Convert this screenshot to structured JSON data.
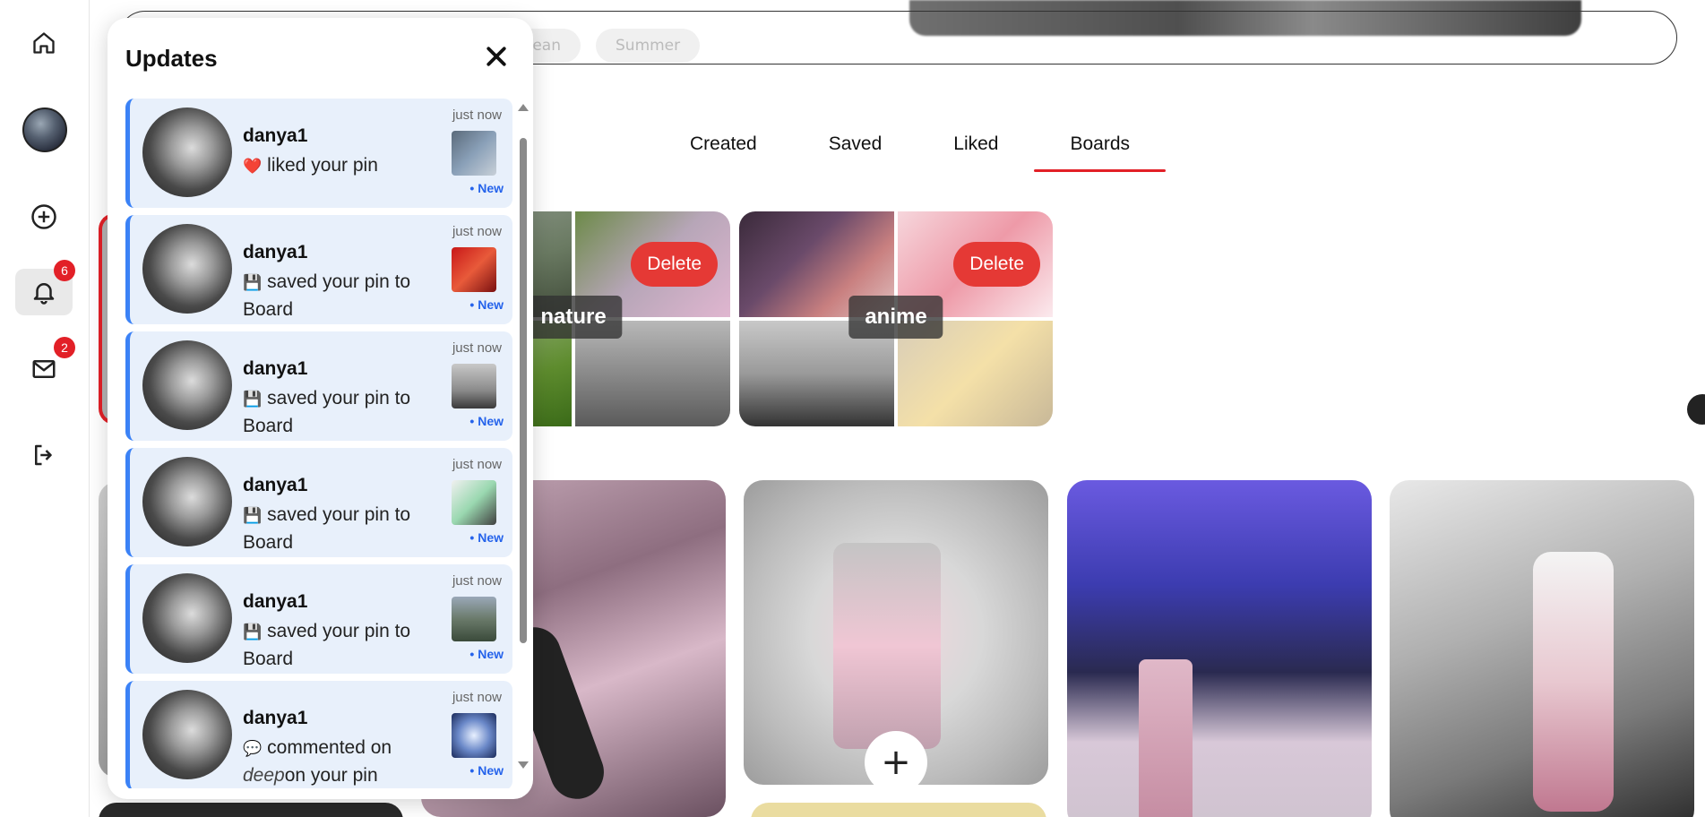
{
  "rail": {
    "items": [
      {
        "icon": "home-icon"
      },
      {
        "icon": "avatar"
      },
      {
        "icon": "plus-circle-icon"
      },
      {
        "icon": "bell-icon",
        "badge": "6"
      },
      {
        "icon": "mail-icon",
        "badge": "2"
      },
      {
        "icon": "logout-icon"
      }
    ]
  },
  "chips": [
    "Korean",
    "Summer"
  ],
  "tabs": [
    "Created",
    "Saved",
    "Liked",
    "Boards"
  ],
  "active_tab": "Boards",
  "boards": [
    {
      "label": "nature",
      "delete_label": "Delete"
    },
    {
      "label": "anime",
      "delete_label": "Delete"
    }
  ],
  "pin_add_label": "+",
  "updates": {
    "title": "Updates",
    "items": [
      {
        "user": "danya1",
        "icon": "heart-icon",
        "glyph": "❤️",
        "action": "liked your pin",
        "time": "just now",
        "new_label": "• New"
      },
      {
        "user": "danya1",
        "icon": "floppy-icon",
        "glyph": "💾",
        "action": "saved your pin to Board",
        "time": "just now",
        "new_label": "• New"
      },
      {
        "user": "danya1",
        "icon": "floppy-icon",
        "glyph": "💾",
        "action": "saved your pin to Board",
        "time": "just now",
        "new_label": "• New"
      },
      {
        "user": "danya1",
        "icon": "floppy-icon",
        "glyph": "💾",
        "action": "saved your pin to Board",
        "time": "just now",
        "new_label": "• New"
      },
      {
        "user": "danya1",
        "icon": "floppy-icon",
        "glyph": "💾",
        "action": "saved your pin to Board",
        "time": "just now",
        "new_label": "• New"
      },
      {
        "user": "danya1",
        "icon": "comment-icon",
        "glyph": "💬",
        "action": "commented on",
        "comment": "deep",
        "suffix": "on your pin",
        "time": "just now",
        "new_label": "• New"
      }
    ]
  },
  "colors": {
    "accent": "#e22027",
    "delete": "#e53935",
    "new": "#2563eb",
    "update_bg": "#e8f0fb",
    "update_border": "#3b82f6"
  }
}
